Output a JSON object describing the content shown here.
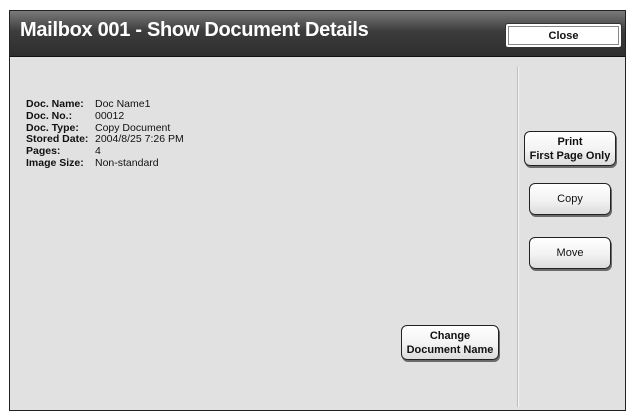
{
  "title": "Mailbox 001 - Show Document Details",
  "close_label": "Close",
  "details": [
    {
      "label": "Doc. Name:",
      "value": "Doc Name1"
    },
    {
      "label": "Doc. No.:",
      "value": "00012"
    },
    {
      "label": "Doc. Type:",
      "value": "Copy Document"
    },
    {
      "label": "Stored Date:",
      "value": "2004/8/25 7:26 PM"
    },
    {
      "label": "Pages:",
      "value": "4"
    },
    {
      "label": "Image Size:",
      "value": "Non-standard"
    }
  ],
  "buttons": {
    "print_first": {
      "line1": "Print",
      "line2": "First Page Only"
    },
    "copy": "Copy",
    "move": "Move",
    "change_name": {
      "line1": "Change",
      "line2": "Document Name"
    }
  }
}
